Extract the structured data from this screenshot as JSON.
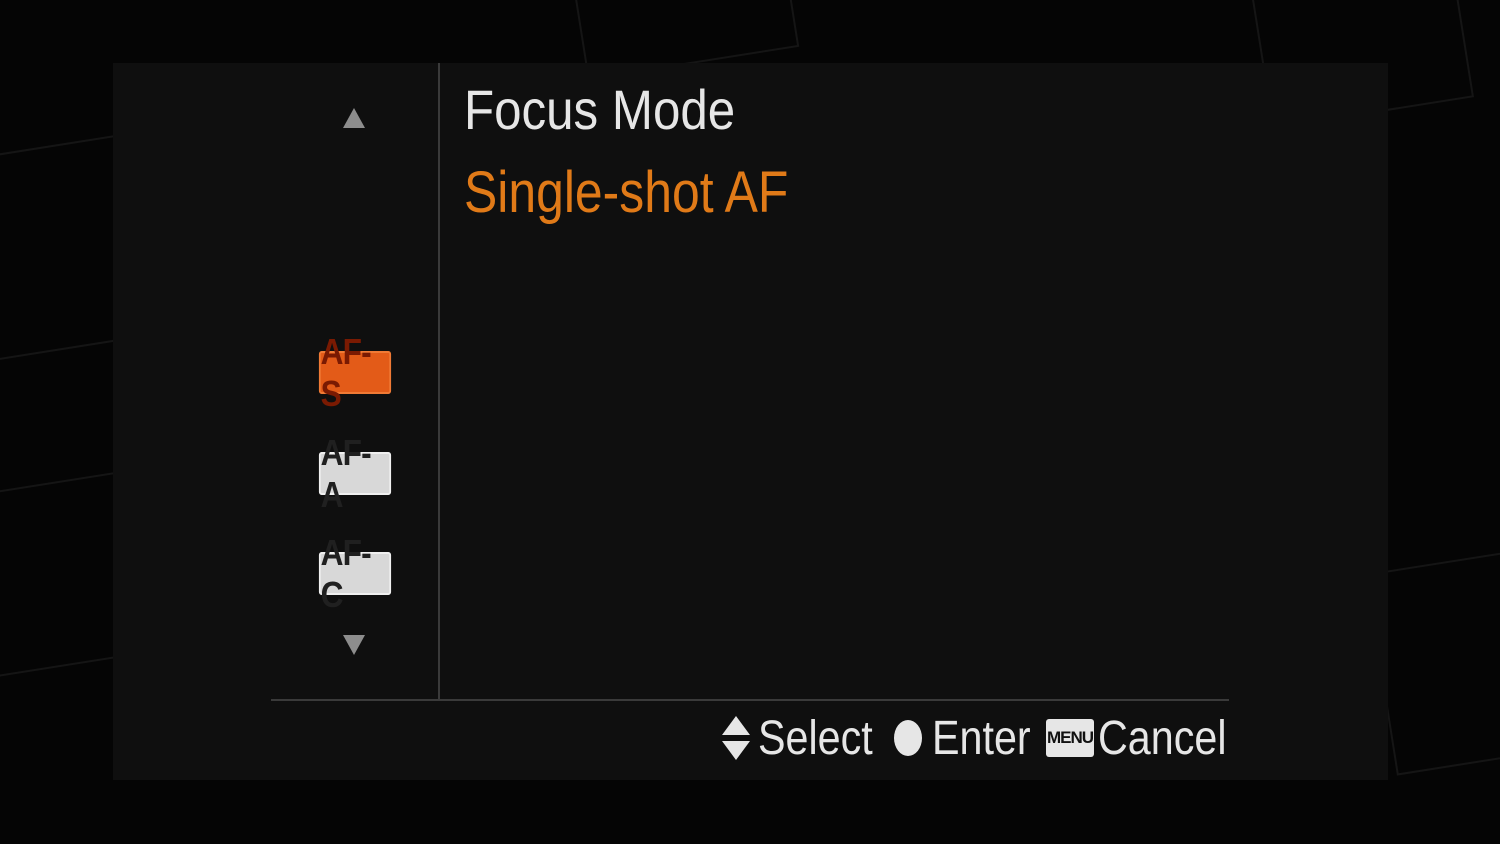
{
  "menu": {
    "title": "Focus Mode",
    "selected_name": "Single-shot AF",
    "options": [
      {
        "label": "AF-S",
        "selected": true
      },
      {
        "label": "AF-A",
        "selected": false
      },
      {
        "label": "AF-C",
        "selected": false
      }
    ]
  },
  "footer": {
    "select_label": "Select",
    "enter_label": "Enter",
    "menu_key": "MENU",
    "cancel_label": "Cancel"
  },
  "colors": {
    "accent": "#e07a18",
    "selected_bg": "#e35b18",
    "text": "#e6e6e6"
  },
  "icons": {
    "scroll_up": "triangle-up-icon",
    "scroll_down": "triangle-down-icon",
    "select": "up-down-arrows-icon",
    "enter": "circle-button-icon",
    "cancel": "menu-key-icon"
  }
}
